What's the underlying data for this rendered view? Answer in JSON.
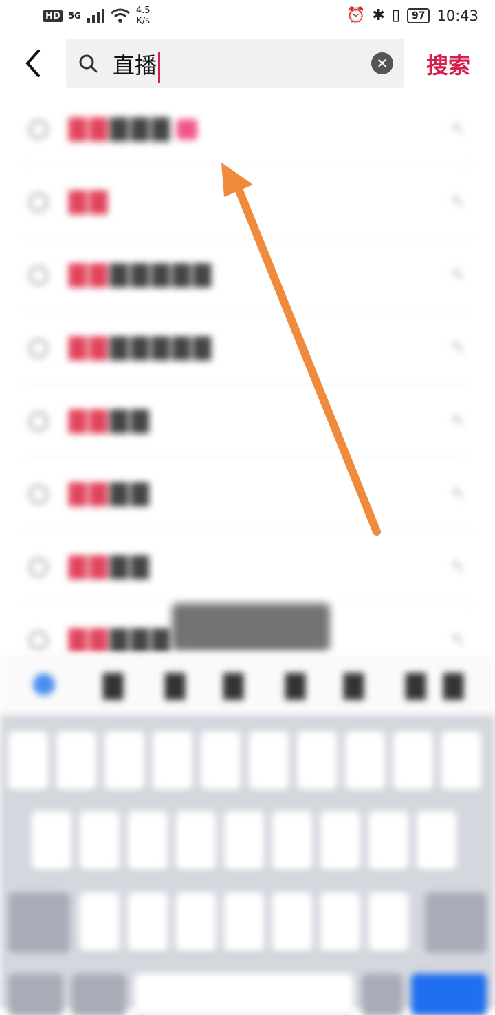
{
  "status_bar": {
    "hd": "HD",
    "signal": "5G",
    "speed_value": "4.5",
    "speed_unit": "K/s",
    "battery": "97",
    "time": "10:43"
  },
  "search": {
    "query": "直播",
    "button_label": "搜索"
  },
  "colors": {
    "accent": "#d6204b",
    "arrow": "#f08a3c"
  }
}
